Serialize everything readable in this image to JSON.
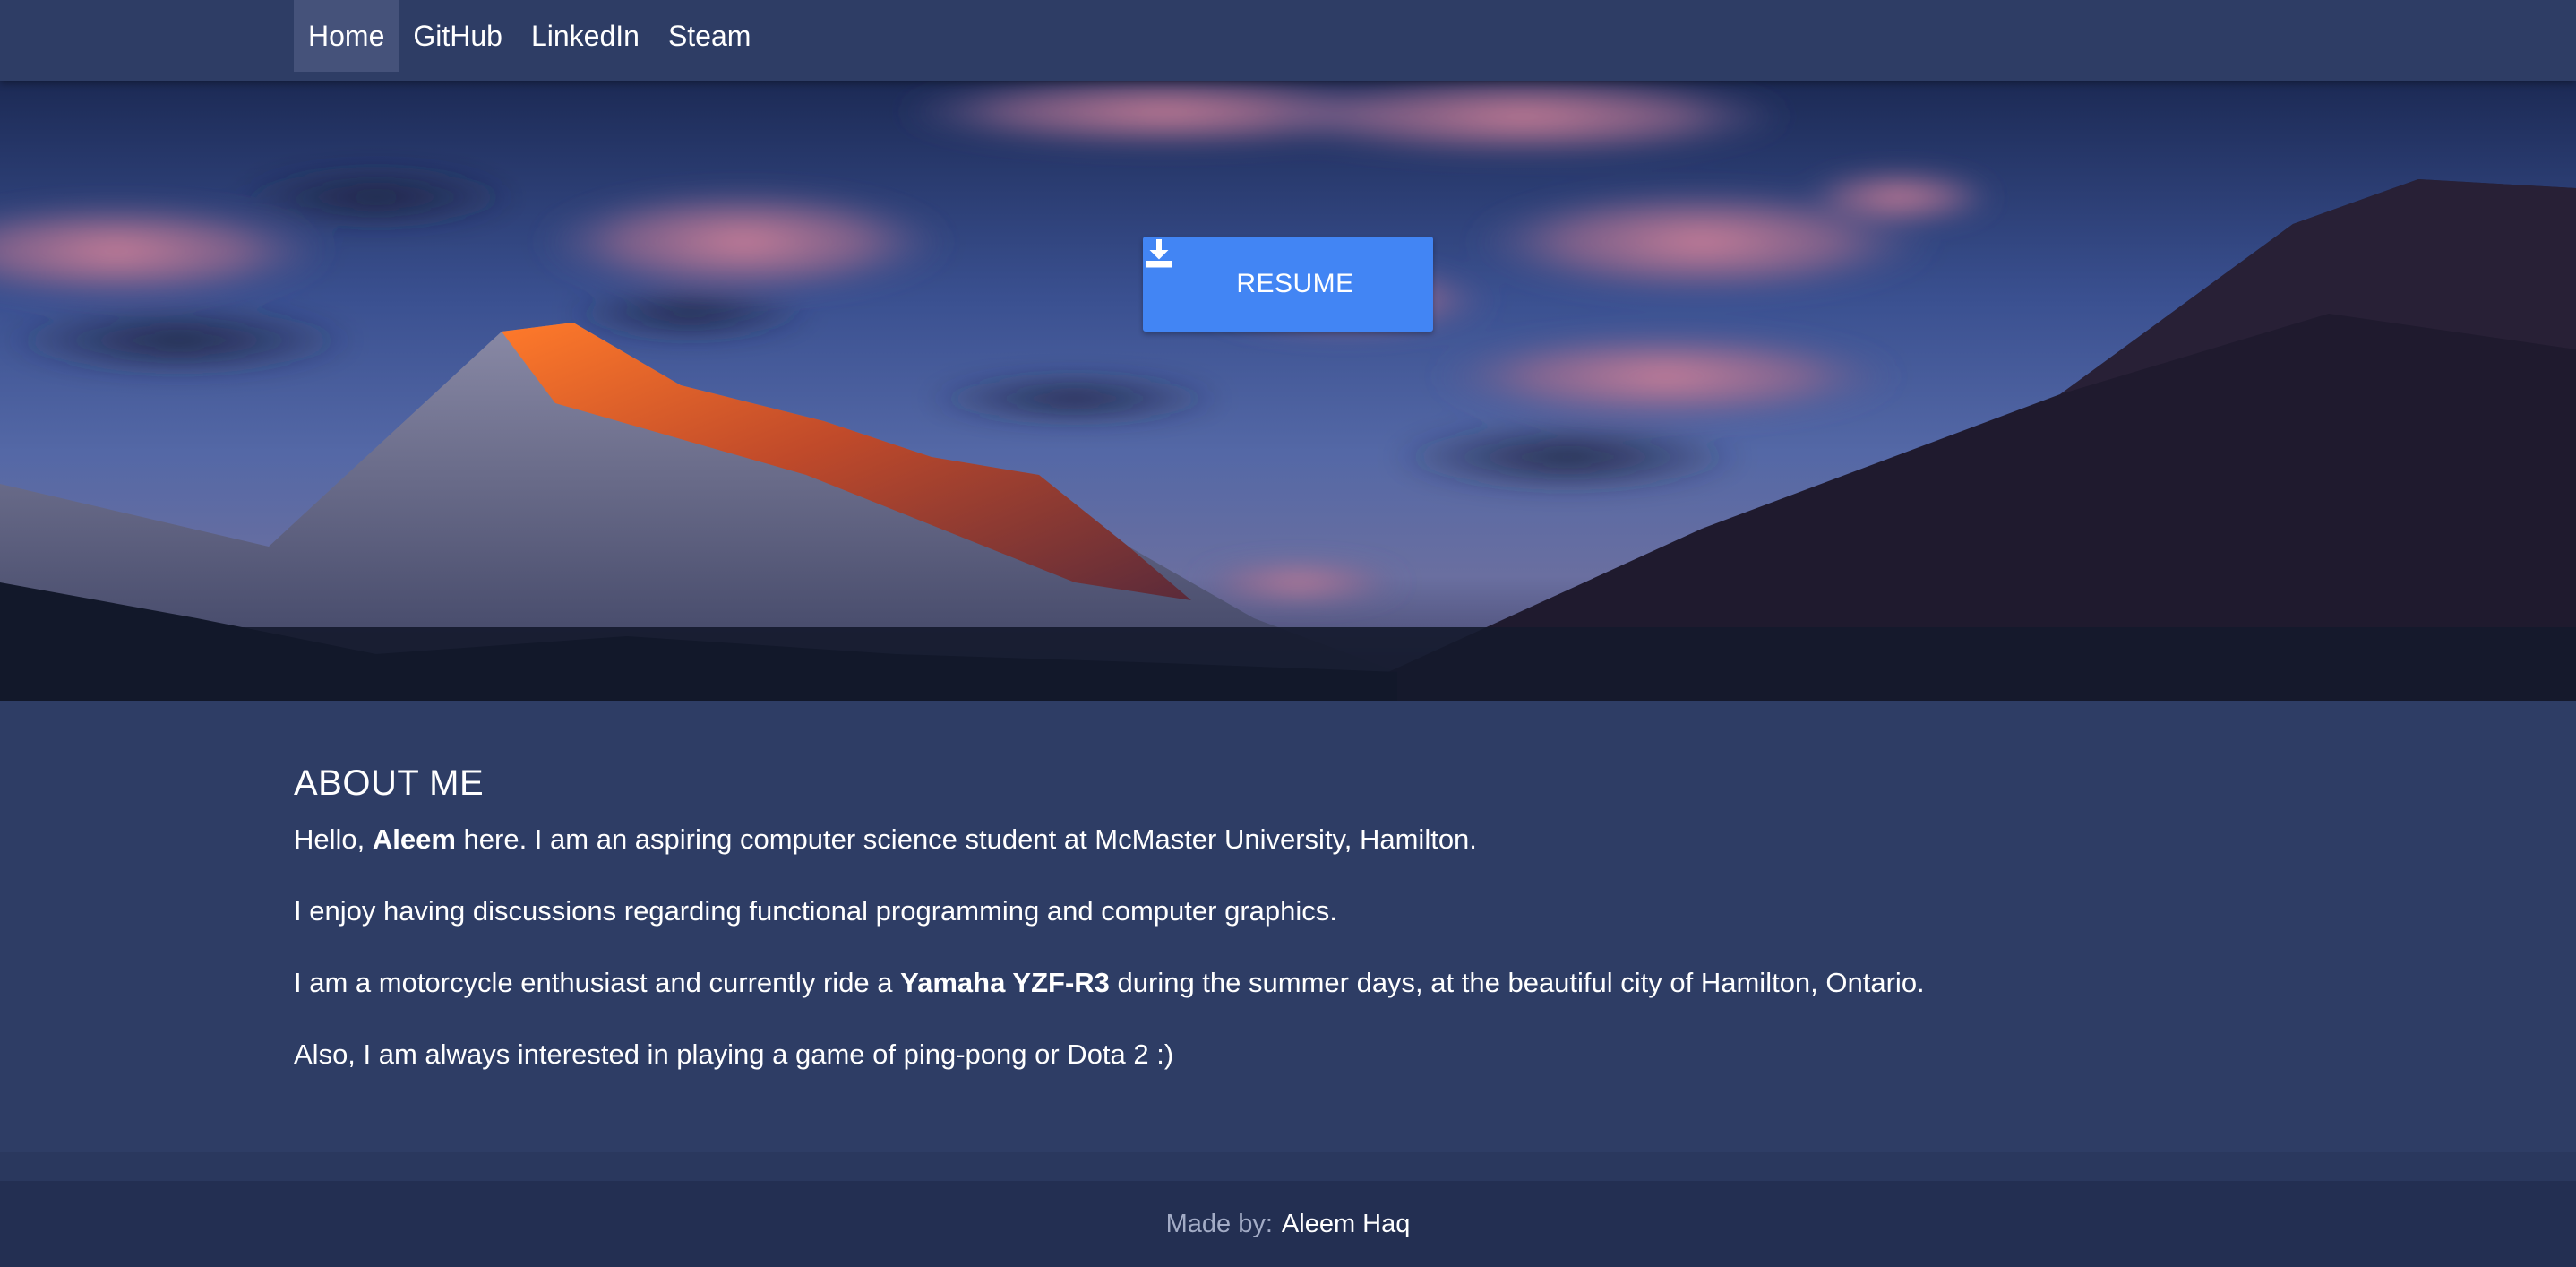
{
  "nav": {
    "items": [
      {
        "label": "Home",
        "active": true
      },
      {
        "label": "GitHub",
        "active": false
      },
      {
        "label": "LinkedIn",
        "active": false
      },
      {
        "label": "Steam",
        "active": false
      }
    ]
  },
  "hero": {
    "resume_label": "RESUME",
    "resume_icon": "download-icon"
  },
  "about": {
    "title": "ABOUT ME",
    "p1_pre": "Hello, ",
    "p1_bold": "Aleem",
    "p1_post": " here. I am an aspiring computer science student at McMaster University, Hamilton.",
    "p2": "I enjoy having discussions regarding functional programming and computer graphics.",
    "p3_pre": "I am a motorcycle enthusiast and currently ride a ",
    "p3_bold": "Yamaha YZF-R3",
    "p3_post": " during the summer days, at the beautiful city of Hamilton, Ontario.",
    "p4": "Also, I am always interested in playing a game of ping-pong or Dota 2 :)"
  },
  "footer": {
    "label": "Made by:",
    "name": "Aleem Haq"
  },
  "colors": {
    "navbar": "#2e3d65",
    "nav_active": "#45527a",
    "resume_button": "#4285f4",
    "body": "#2e3d65",
    "footer": "#232f52"
  }
}
